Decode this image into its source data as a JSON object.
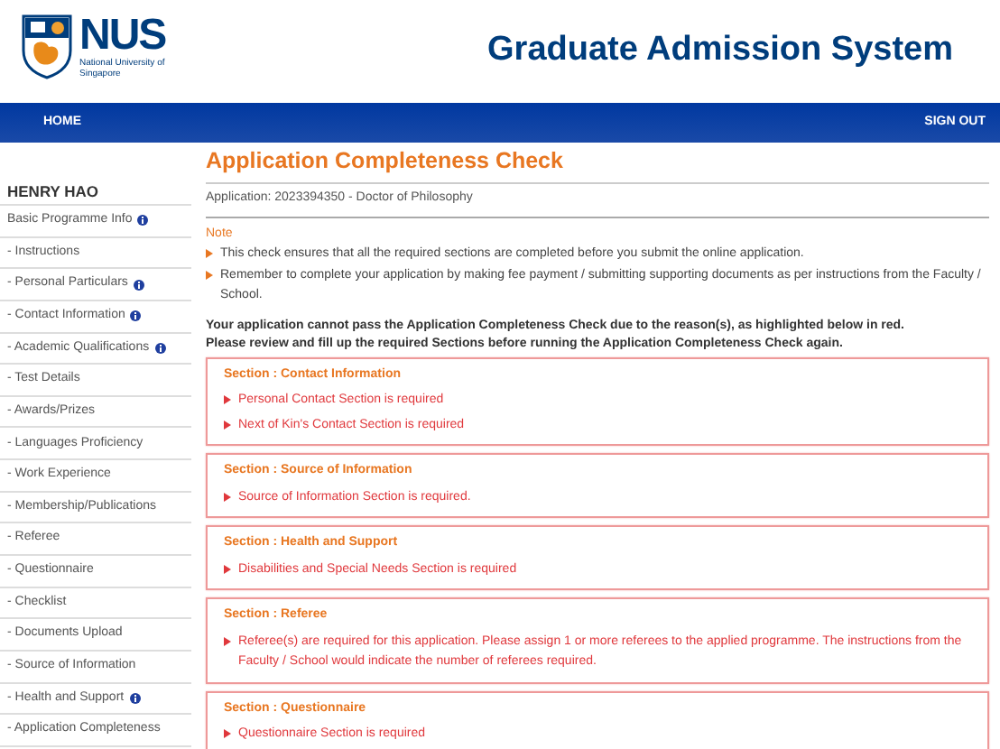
{
  "header": {
    "logo_text": "NUS",
    "logo_subtitle": "National University of Singapore",
    "title": "Graduate Admission System"
  },
  "nav": {
    "left": "HOME",
    "right": "SIGN OUT"
  },
  "sidebar": {
    "user": "HENRY HAO",
    "items": [
      {
        "label": "Basic Programme Info",
        "info": true
      },
      {
        "label": "- Instructions",
        "info": false
      },
      {
        "label": "- Personal Particulars",
        "info": true
      },
      {
        "label": "- Contact Information",
        "info": true
      },
      {
        "label": "- Academic Qualifications",
        "info": true
      },
      {
        "label": "- Test Details",
        "info": false
      },
      {
        "label": "- Awards/Prizes",
        "info": false
      },
      {
        "label": "- Languages Proficiency",
        "info": false
      },
      {
        "label": "- Work Experience",
        "info": false
      },
      {
        "label": "- Membership/Publications",
        "info": false
      },
      {
        "label": "- Referee",
        "info": false
      },
      {
        "label": "- Questionnaire",
        "info": false
      },
      {
        "label": "- Checklist",
        "info": false
      },
      {
        "label": "- Documents Upload",
        "info": false
      },
      {
        "label": "- Source of Information",
        "info": false
      },
      {
        "label": "- Health and Support",
        "info": true
      },
      {
        "label": "- Application Completeness",
        "info": false
      }
    ]
  },
  "main": {
    "title": "Application Completeness Check",
    "application": "Application: 2023394350 - Doctor of Philosophy",
    "note_label": "Note",
    "notes": [
      "This check ensures that all the required sections are completed before you submit the online application.",
      "Remember to complete your application by making fee payment / submitting supporting documents as per instructions from the Faculty / School."
    ],
    "warning": [
      "Your application cannot pass the Application Completeness Check due to the reason(s), as highlighted below in red.",
      "Please review and fill up the required Sections before running the Application Completeness Check again."
    ],
    "sections": [
      {
        "title": "Section : Contact Information",
        "errors": [
          "Personal Contact Section is required",
          "Next of Kin's Contact Section is required"
        ]
      },
      {
        "title": "Section : Source of Information",
        "errors": [
          "Source of Information Section is required."
        ]
      },
      {
        "title": "Section : Health and Support",
        "errors": [
          "Disabilities and Special Needs Section is required"
        ]
      },
      {
        "title": "Section : Referee",
        "errors": [
          "Referee(s) are required for this application. Please assign 1 or more referees to the applied programme. The instructions from the Faculty / School would indicate the number of referees required."
        ]
      },
      {
        "title": "Section : Questionnaire",
        "errors": [
          "Questionnaire Section is required"
        ]
      }
    ]
  }
}
